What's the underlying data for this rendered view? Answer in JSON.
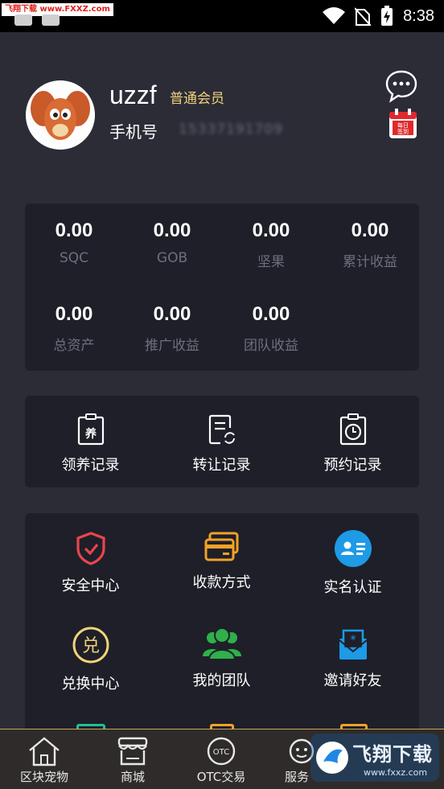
{
  "status_bar": {
    "watermark": "飞翔下载 www.FXXZ.com",
    "time": "8:38"
  },
  "profile": {
    "username": "uzzf",
    "member_level": "普通会员",
    "phone_label": "手机号",
    "phone_value": "15337191709"
  },
  "sign_in_badge": "每日\n签到",
  "stats": [
    {
      "value": "0.00",
      "label": "SQC"
    },
    {
      "value": "0.00",
      "label": "GOB"
    },
    {
      "value": "0.00",
      "label": "坚果"
    },
    {
      "value": "0.00",
      "label": "累计收益"
    },
    {
      "value": "0.00",
      "label": "总资产"
    },
    {
      "value": "0.00",
      "label": "推广收益"
    },
    {
      "value": "0.00",
      "label": "团队收益"
    }
  ],
  "records": [
    {
      "label": "领养记录",
      "icon": "adopt-record-icon",
      "glyph": "养"
    },
    {
      "label": "转让记录",
      "icon": "transfer-record-icon"
    },
    {
      "label": "预约记录",
      "icon": "reservation-record-icon"
    }
  ],
  "services": [
    {
      "label": "安全中心",
      "icon": "shield-icon",
      "color": "#e8454d"
    },
    {
      "label": "收款方式",
      "icon": "card-icon",
      "color": "#f0a227"
    },
    {
      "label": "实名认证",
      "icon": "id-card-icon",
      "color": "#1e9ae6"
    },
    {
      "label": "兑换中心",
      "icon": "exchange-icon",
      "color": "#f2d27a",
      "glyph": "兑"
    },
    {
      "label": "我的团队",
      "icon": "team-icon",
      "color": "#2fb04a"
    },
    {
      "label": "邀请好友",
      "icon": "invite-icon",
      "color": "#1e9ae6"
    }
  ],
  "bottom_nav": [
    {
      "label": "区块宠物",
      "icon": "home-icon"
    },
    {
      "label": "商城",
      "icon": "store-icon"
    },
    {
      "label": "OTC交易",
      "icon": "otc-icon",
      "badge": "OTC"
    },
    {
      "label": "服务",
      "icon": "service-icon"
    }
  ],
  "watermark_br": {
    "title": "飞翔下载",
    "url": "www.fxxz.com"
  }
}
